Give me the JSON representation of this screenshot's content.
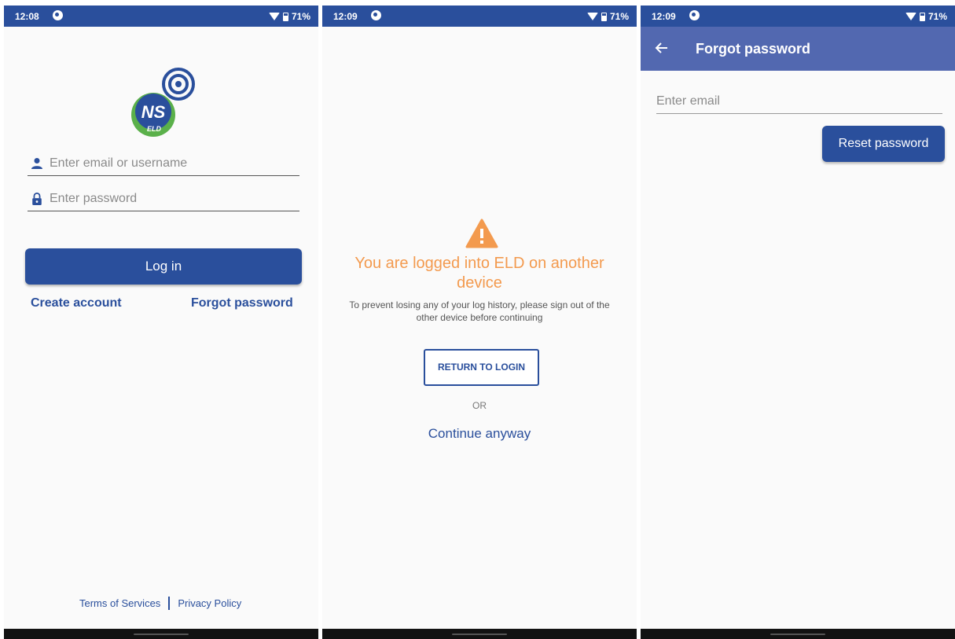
{
  "colors": {
    "primary": "#2a4f9c",
    "app_bar": "#5268b0",
    "warning": "#f39a4e"
  },
  "status_bar": {
    "battery": "71%"
  },
  "login_screen": {
    "time": "12:08",
    "logo_text": "ELD",
    "email_placeholder": "Enter email or username",
    "password_placeholder": "Enter password",
    "login_label": "Log in",
    "create_account": "Create account",
    "forgot_password": "Forgot password",
    "terms": "Terms of Services",
    "privacy": "Privacy Policy"
  },
  "warning_screen": {
    "time": "12:09",
    "title": "You are logged into ELD on another device",
    "message": "To prevent losing any of your log history, please sign out of the other device before continuing",
    "return_label": "RETURN TO LOGIN",
    "or_label": "OR",
    "continue_label": "Continue anyway"
  },
  "forgot_screen": {
    "time": "12:09",
    "title": "Forgot password",
    "email_placeholder": "Enter email",
    "reset_label": "Reset password"
  }
}
